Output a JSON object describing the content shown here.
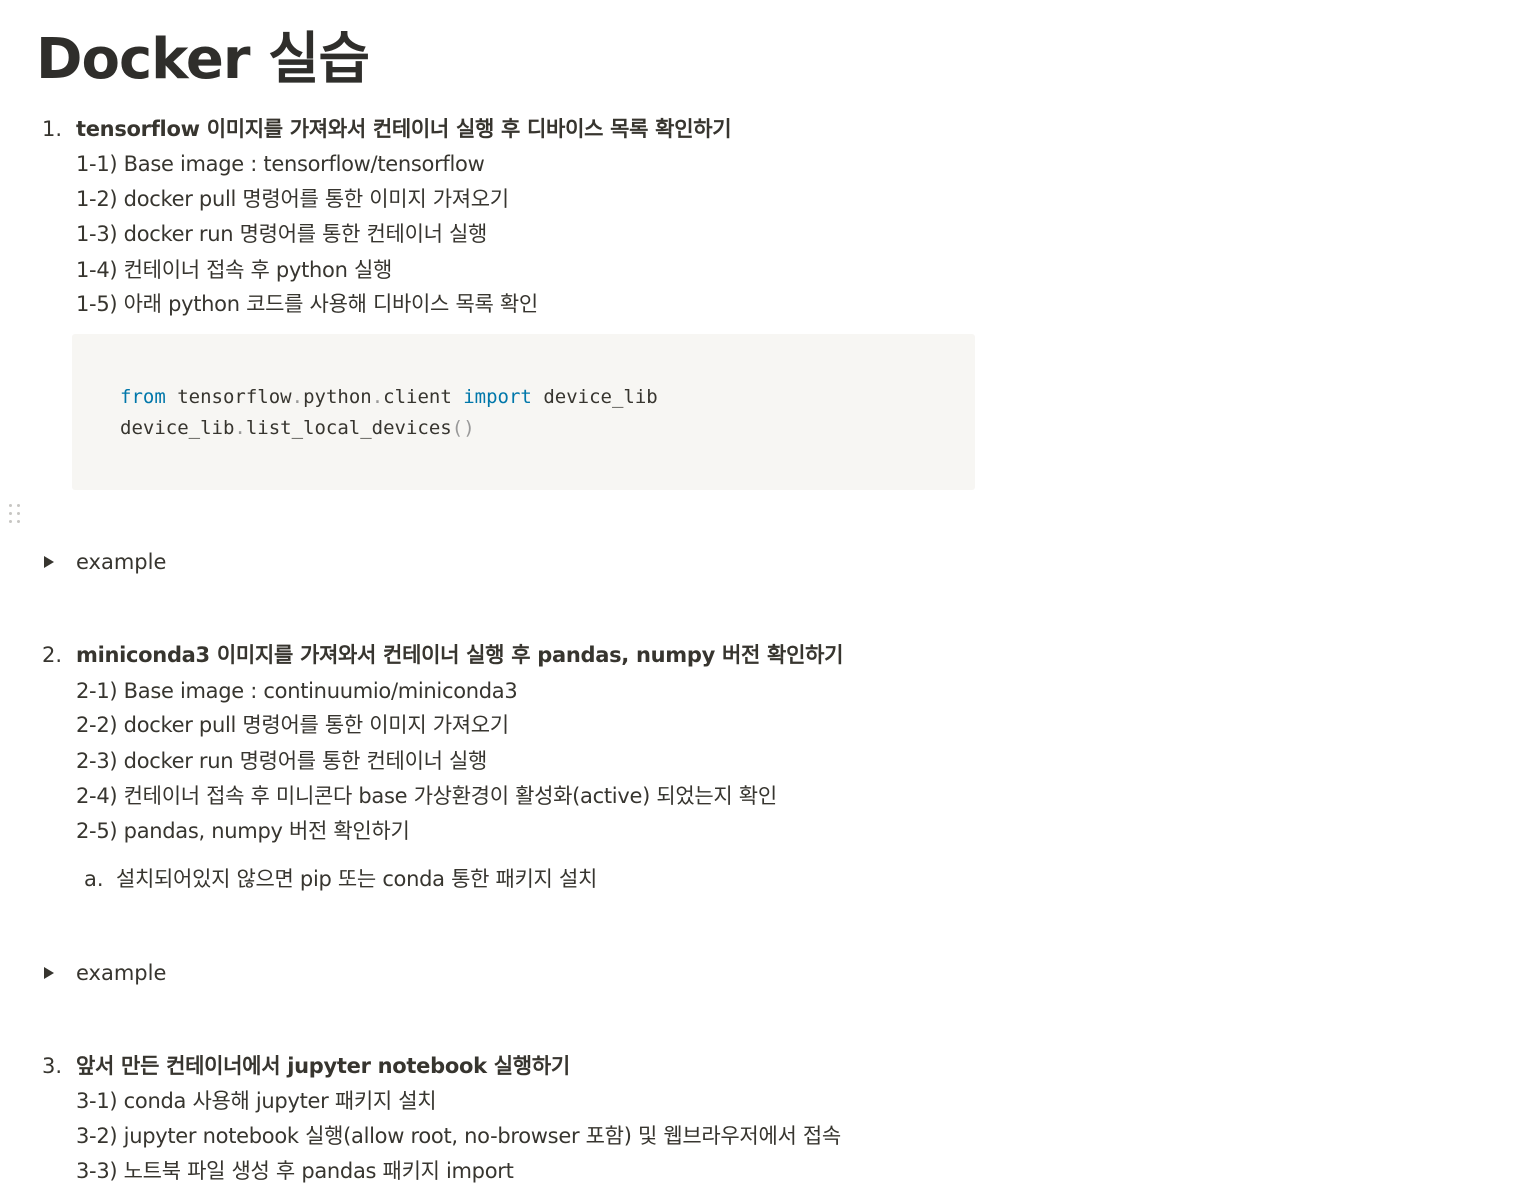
{
  "page": {
    "title": "Docker 실습"
  },
  "sections": [
    {
      "number": "1.",
      "heading": "tensorflow 이미지를 가져와서 컨테이너 실행 후 디바이스 목록 확인하기",
      "items": [
        "1-1) Base image : tensorflow/tensorflow",
        "1-2) docker pull 명령어를 통한 이미지 가져오기",
        "1-3) docker run 명령어를 통한 컨테이너 실행",
        "1-4) 컨테이너 접속 후 python 실행",
        "1-5) 아래 python 코드를 사용해 디바이스 목록 확인"
      ],
      "code": {
        "line1": {
          "kw_from": "from",
          "module_a": " tensorflow",
          "dot1": ".",
          "module_b": "python",
          "dot2": ".",
          "module_c": "client ",
          "kw_import": "import",
          "name": " device_lib"
        },
        "line2": {
          "obj": "device_lib",
          "dot": ".",
          "method": "list_local_devices",
          "parens": "()"
        }
      },
      "toggle_label": "example"
    },
    {
      "number": "2.",
      "heading": "miniconda3 이미지를 가져와서 컨테이너 실행 후 pandas, numpy 버전 확인하기",
      "items": [
        "2-1) Base image : continuumio/miniconda3",
        "2-2) docker pull 명령어를 통한 이미지 가져오기",
        "2-3) docker run 명령어를 통한 컨테이너 실행",
        "2-4) 컨테이너 접속 후 미니콘다 base 가상환경이 활성화(active) 되었는지 확인",
        "2-5) pandas, numpy 버전 확인하기"
      ],
      "subitem": {
        "marker": "a.",
        "text": "설치되어있지 않으면 pip 또는 conda 통한 패키지 설치"
      },
      "toggle_label": "example"
    },
    {
      "number": "3.",
      "heading": "앞서 만든 컨테이너에서 jupyter notebook 실행하기",
      "items": [
        "3-1) conda 사용해 jupyter 패키지 설치",
        "3-2) jupyter notebook 실행(allow root, no-browser 포함) 및 웹브라우저에서 접속",
        "3-3) 노트북 파일 생성 후 pandas 패키지 import"
      ]
    }
  ],
  "icons": {
    "drag_handle": "drag-handle-icon",
    "toggle": "toggle-triangle-icon"
  },
  "colors": {
    "text": "#37352f",
    "code_background": "#f7f6f3",
    "code_keyword": "#0077aa",
    "code_punctuation": "#999999"
  }
}
